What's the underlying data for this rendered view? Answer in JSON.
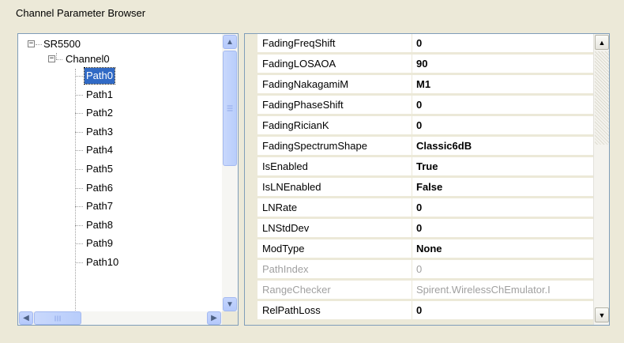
{
  "window": {
    "title": "Channel Parameter Browser"
  },
  "tree": {
    "root": {
      "label": "SR5500",
      "expander": "−"
    },
    "channel": {
      "label": "Channel0",
      "expander": "−"
    },
    "paths": [
      {
        "label": "Path0",
        "selected": true
      },
      {
        "label": "Path1"
      },
      {
        "label": "Path2"
      },
      {
        "label": "Path3"
      },
      {
        "label": "Path4"
      },
      {
        "label": "Path5"
      },
      {
        "label": "Path6"
      },
      {
        "label": "Path7"
      },
      {
        "label": "Path8"
      },
      {
        "label": "Path9"
      },
      {
        "label": "Path10"
      }
    ]
  },
  "properties": [
    {
      "name": "FadingFreqShift",
      "value": "0"
    },
    {
      "name": "FadingLOSAOA",
      "value": "90"
    },
    {
      "name": "FadingNakagamiM",
      "value": "M1"
    },
    {
      "name": "FadingPhaseShift",
      "value": "0"
    },
    {
      "name": "FadingRicianK",
      "value": "0"
    },
    {
      "name": "FadingSpectrumShape",
      "value": "Classic6dB"
    },
    {
      "name": "IsEnabled",
      "value": "True"
    },
    {
      "name": "IsLNEnabled",
      "value": "False"
    },
    {
      "name": "LNRate",
      "value": "0"
    },
    {
      "name": "LNStdDev",
      "value": "0"
    },
    {
      "name": "ModType",
      "value": "None"
    },
    {
      "name": "PathIndex",
      "value": "0",
      "disabled": true
    },
    {
      "name": "RangeChecker",
      "value": "Spirent.WirelessChEmulator.I",
      "disabled": true
    },
    {
      "name": "RelPathLoss",
      "value": "0"
    }
  ],
  "icons": {
    "scroll_up": "▲",
    "scroll_down": "▼",
    "scroll_left": "◀",
    "scroll_right": "▶"
  },
  "colors": {
    "selection": "#316ac5",
    "window_bg": "#ece9d8",
    "border": "#7f9db9"
  }
}
